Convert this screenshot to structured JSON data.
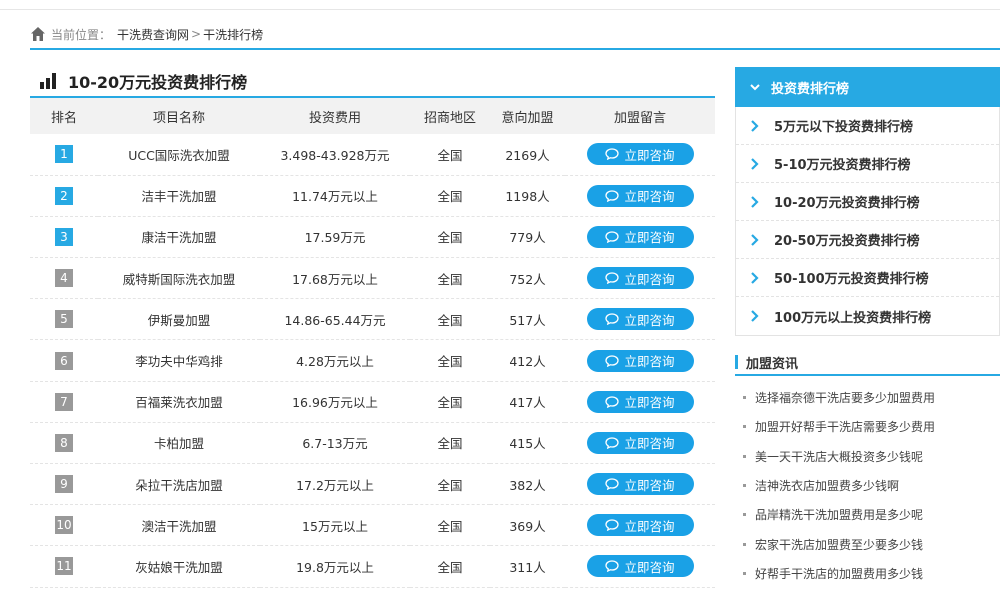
{
  "breadcrumb": {
    "label": "当前位置：",
    "items": [
      "干洗费查询网",
      "干洗排行榜"
    ],
    "separator": ">"
  },
  "main": {
    "title": "10-20万元投资费排行榜",
    "columns": [
      "排名",
      "项目名称",
      "投资费用",
      "招商地区",
      "意向加盟",
      "加盟留言"
    ],
    "button_label": "立即咨询",
    "rows": [
      {
        "rank": "1",
        "name": "UCC国际洗衣加盟",
        "cost": "3.498-43.928万元",
        "region": "全国",
        "intent": "2169人"
      },
      {
        "rank": "2",
        "name": "洁丰干洗加盟",
        "cost": "11.74万元以上",
        "region": "全国",
        "intent": "1198人"
      },
      {
        "rank": "3",
        "name": "康洁干洗加盟",
        "cost": "17.59万元",
        "region": "全国",
        "intent": "779人"
      },
      {
        "rank": "4",
        "name": "威特斯国际洗衣加盟",
        "cost": "17.68万元以上",
        "region": "全国",
        "intent": "752人"
      },
      {
        "rank": "5",
        "name": "伊斯曼加盟",
        "cost": "14.86-65.44万元",
        "region": "全国",
        "intent": "517人"
      },
      {
        "rank": "6",
        "name": "李功夫中华鸡排",
        "cost": "4.28万元以上",
        "region": "全国",
        "intent": "412人"
      },
      {
        "rank": "7",
        "name": "百福莱洗衣加盟",
        "cost": "16.96万元以上",
        "region": "全国",
        "intent": "417人"
      },
      {
        "rank": "8",
        "name": "卡柏加盟",
        "cost": "6.7-13万元",
        "region": "全国",
        "intent": "415人"
      },
      {
        "rank": "9",
        "name": "朵拉干洗店加盟",
        "cost": "17.2万元以上",
        "region": "全国",
        "intent": "382人"
      },
      {
        "rank": "10",
        "name": "澳洁干洗加盟",
        "cost": "15万元以上",
        "region": "全国",
        "intent": "369人"
      },
      {
        "rank": "11",
        "name": "灰姑娘干洗加盟",
        "cost": "19.8万元以上",
        "region": "全国",
        "intent": "311人"
      }
    ]
  },
  "sidebar": {
    "title": "投资费排行榜",
    "items": [
      "5万元以下投资费排行榜",
      "5-10万元投资费排行榜",
      "10-20万元投资费排行榜",
      "20-50万元投资费排行榜",
      "50-100万元投资费排行榜",
      "100万元以上投资费排行榜"
    ]
  },
  "news": {
    "title": "加盟资讯",
    "items": [
      "选择福奈德干洗店要多少加盟费用",
      "加盟开好帮手干洗店需要多少费用",
      "美一天干洗店大概投资多少钱呢",
      "洁神洗衣店加盟费多少钱啊",
      "品岸精洗干洗加盟费用是多少呢",
      "宏家干洗店加盟费至少要多少钱",
      "好帮手干洗店的加盟费用多少钱"
    ]
  },
  "colors": {
    "accent": "#27a9e3",
    "button": "#1aa1e6",
    "rank_gray": "#999999"
  }
}
